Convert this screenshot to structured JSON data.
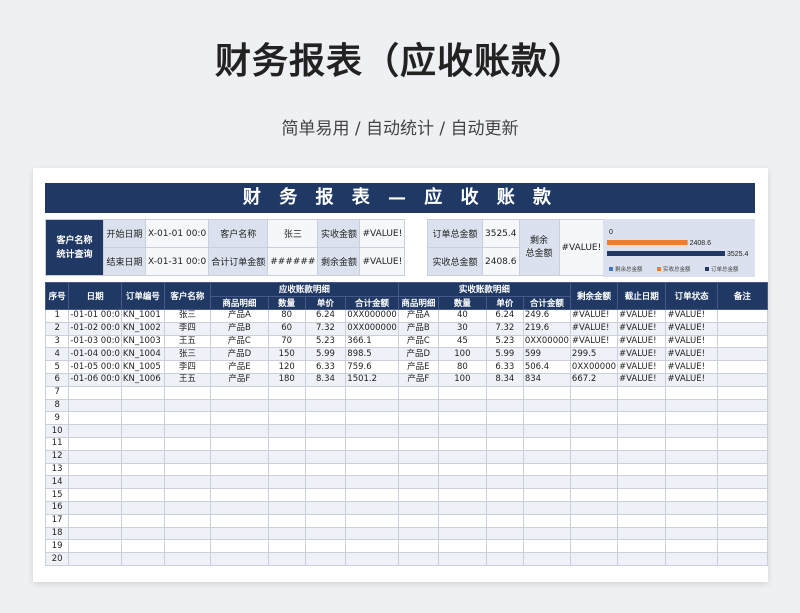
{
  "header": {
    "title": "财务报表（应收账款）",
    "subtitle": "简单易用 / 自动统计 / 自动更新"
  },
  "sheet": {
    "banner": "财 务 报 表 — 应 收 账 款",
    "summary": {
      "query_label": "客户名称\n统计查询",
      "start_date_label": "开始日期",
      "start_date_value": "X-01-01 00:0",
      "end_date_label": "结束日期",
      "end_date_value": "X-01-31 00:0",
      "customer_label": "客户名称",
      "customer_value": "张三",
      "order_total_label": "合计订单金额",
      "order_total_value": "######",
      "received_label": "实收金额",
      "received_value": "#VALUE!",
      "remaining_label": "剩余金额",
      "remaining_value": "#VALUE!",
      "order_sum_label": "订单总金额",
      "order_sum_value": "3525.4",
      "received_sum_label": "实收总金额",
      "received_sum_value": "2408.6",
      "remaining_sum_label": "剩余\n总金额",
      "remaining_sum_value": "#VALUE!"
    },
    "mini_chart": {
      "bars": [
        {
          "label": "0",
          "value": 0,
          "color": "#4472c4"
        },
        {
          "label": "2408.6",
          "value": 2408.6,
          "color": "#ed7d31"
        },
        {
          "label": "3525.4",
          "value": 3525.4,
          "color": "#1f3864"
        }
      ],
      "legend": [
        "剩余总金额",
        "实收总金额",
        "订单总金额"
      ],
      "legend_colors": [
        "#4472c4",
        "#ed7d31",
        "#1f3864"
      ]
    },
    "table": {
      "headers_top": {
        "no": "序号",
        "date": "日期",
        "order_no": "订单编号",
        "customer": "客户名称",
        "receivable_group": "应收账款明细",
        "received_group": "实收账款明细",
        "remaining": "剩余金额",
        "deadline": "截止日期",
        "status": "订单状态",
        "note": "备注"
      },
      "headers_sub": [
        "商品明细",
        "数量",
        "单价",
        "合计金额",
        "商品明细",
        "数量",
        "单价",
        "合计金额"
      ],
      "rows": [
        [
          "1",
          "-01-01 00:0",
          "KN_1001",
          "张三",
          "产品A",
          "80",
          "6.24",
          "0XX000000",
          "产品A",
          "40",
          "6.24",
          "249.6",
          "#VALUE!",
          "#VALUE!",
          "#VALUE!",
          ""
        ],
        [
          "2",
          "-01-02 00:0",
          "KN_1002",
          "李四",
          "产品B",
          "60",
          "7.32",
          "0XX000000",
          "产品B",
          "30",
          "7.32",
          "219.6",
          "#VALUE!",
          "#VALUE!",
          "#VALUE!",
          ""
        ],
        [
          "3",
          "-01-03 00:0",
          "KN_1003",
          "王五",
          "产品C",
          "70",
          "5.23",
          "366.1",
          "产品C",
          "45",
          "5.23",
          "0XX00000",
          "#VALUE!",
          "#VALUE!",
          "#VALUE!",
          ""
        ],
        [
          "4",
          "-01-04 00:0",
          "KN_1004",
          "张三",
          "产品D",
          "150",
          "5.99",
          "898.5",
          "产品D",
          "100",
          "5.99",
          "599",
          "299.5",
          "#VALUE!",
          "#VALUE!",
          ""
        ],
        [
          "5",
          "-01-05 00:0",
          "KN_1005",
          "李四",
          "产品E",
          "120",
          "6.33",
          "759.6",
          "产品E",
          "80",
          "6.33",
          "506.4",
          "0XX00000",
          "#VALUE!",
          "#VALUE!",
          ""
        ],
        [
          "6",
          "-01-06 00:0",
          "KN_1006",
          "王五",
          "产品F",
          "180",
          "8.34",
          "1501.2",
          "产品F",
          "100",
          "8.34",
          "834",
          "667.2",
          "#VALUE!",
          "#VALUE!",
          ""
        ],
        [
          "7",
          "",
          "",
          "",
          "",
          "",
          "",
          "",
          "",
          "",
          "",
          "",
          "",
          "",
          "",
          ""
        ],
        [
          "8",
          "",
          "",
          "",
          "",
          "",
          "",
          "",
          "",
          "",
          "",
          "",
          "",
          "",
          "",
          ""
        ],
        [
          "9",
          "",
          "",
          "",
          "",
          "",
          "",
          "",
          "",
          "",
          "",
          "",
          "",
          "",
          "",
          ""
        ],
        [
          "10",
          "",
          "",
          "",
          "",
          "",
          "",
          "",
          "",
          "",
          "",
          "",
          "",
          "",
          "",
          ""
        ],
        [
          "11",
          "",
          "",
          "",
          "",
          "",
          "",
          "",
          "",
          "",
          "",
          "",
          "",
          "",
          "",
          ""
        ],
        [
          "12",
          "",
          "",
          "",
          "",
          "",
          "",
          "",
          "",
          "",
          "",
          "",
          "",
          "",
          "",
          ""
        ],
        [
          "13",
          "",
          "",
          "",
          "",
          "",
          "",
          "",
          "",
          "",
          "",
          "",
          "",
          "",
          "",
          ""
        ],
        [
          "14",
          "",
          "",
          "",
          "",
          "",
          "",
          "",
          "",
          "",
          "",
          "",
          "",
          "",
          "",
          ""
        ],
        [
          "15",
          "",
          "",
          "",
          "",
          "",
          "",
          "",
          "",
          "",
          "",
          "",
          "",
          "",
          "",
          ""
        ],
        [
          "16",
          "",
          "",
          "",
          "",
          "",
          "",
          "",
          "",
          "",
          "",
          "",
          "",
          "",
          "",
          ""
        ],
        [
          "17",
          "",
          "",
          "",
          "",
          "",
          "",
          "",
          "",
          "",
          "",
          "",
          "",
          "",
          "",
          ""
        ],
        [
          "18",
          "",
          "",
          "",
          "",
          "",
          "",
          "",
          "",
          "",
          "",
          "",
          "",
          "",
          "",
          ""
        ],
        [
          "19",
          "",
          "",
          "",
          "",
          "",
          "",
          "",
          "",
          "",
          "",
          "",
          "",
          "",
          "",
          ""
        ],
        [
          "20",
          "",
          "",
          "",
          "",
          "",
          "",
          "",
          "",
          "",
          "",
          "",
          "",
          "",
          "",
          ""
        ]
      ]
    }
  }
}
